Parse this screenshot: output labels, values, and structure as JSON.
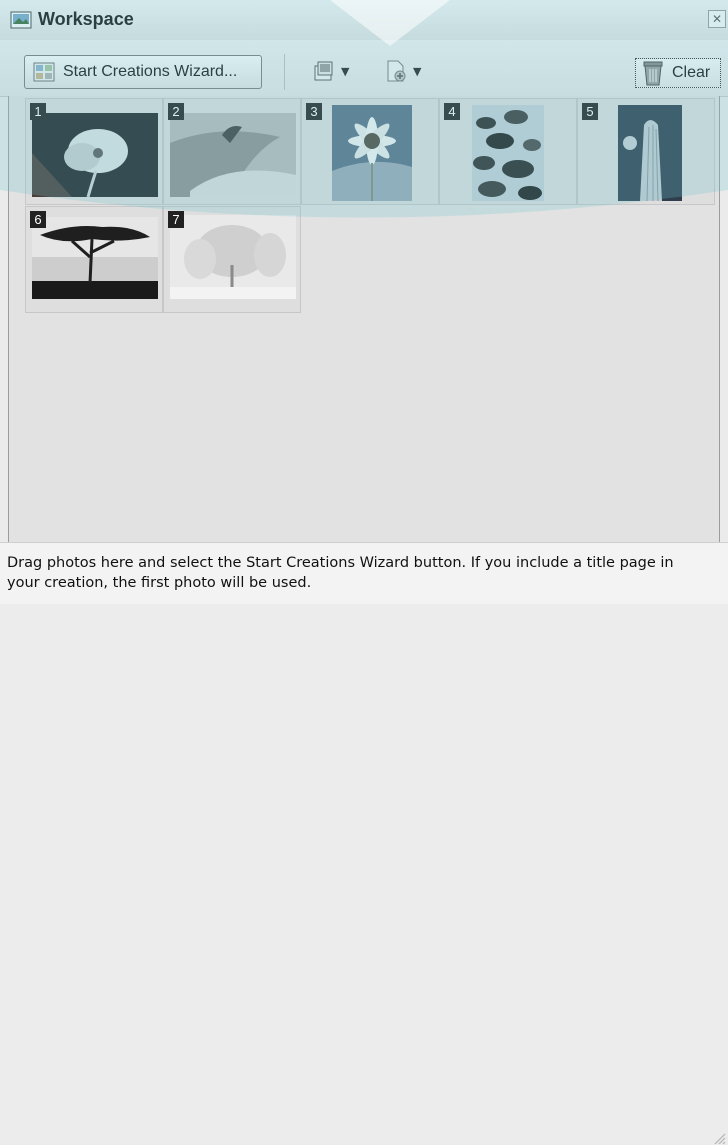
{
  "window": {
    "title": "Workspace",
    "icon": "workspace-photo-icon",
    "close_icon": "close-icon"
  },
  "toolbar": {
    "wizard_label": "Start Creations Wizard...",
    "wizard_icon": "wizard-icon",
    "tool_1_icon": "photo-frame-icon",
    "tool_2_icon": "add-page-icon",
    "clear_label": "Clear",
    "clear_icon": "trash-icon"
  },
  "thumbnails": [
    {
      "index": "1",
      "subject": "poppy flower"
    },
    {
      "index": "2",
      "subject": "sand dune"
    },
    {
      "index": "3",
      "subject": "daisy"
    },
    {
      "index": "4",
      "subject": "river stones"
    },
    {
      "index": "5",
      "subject": "cactus"
    },
    {
      "index": "6",
      "subject": "acacia tree"
    },
    {
      "index": "7",
      "subject": "snowy tree"
    }
  ],
  "status": {
    "message": "Drag photos here and select the Start Creations Wizard button. If you include a title page in your creation, the first photo will be used."
  },
  "colors": {
    "overlay": "#6fc6d2",
    "number_badge": "#222222"
  }
}
